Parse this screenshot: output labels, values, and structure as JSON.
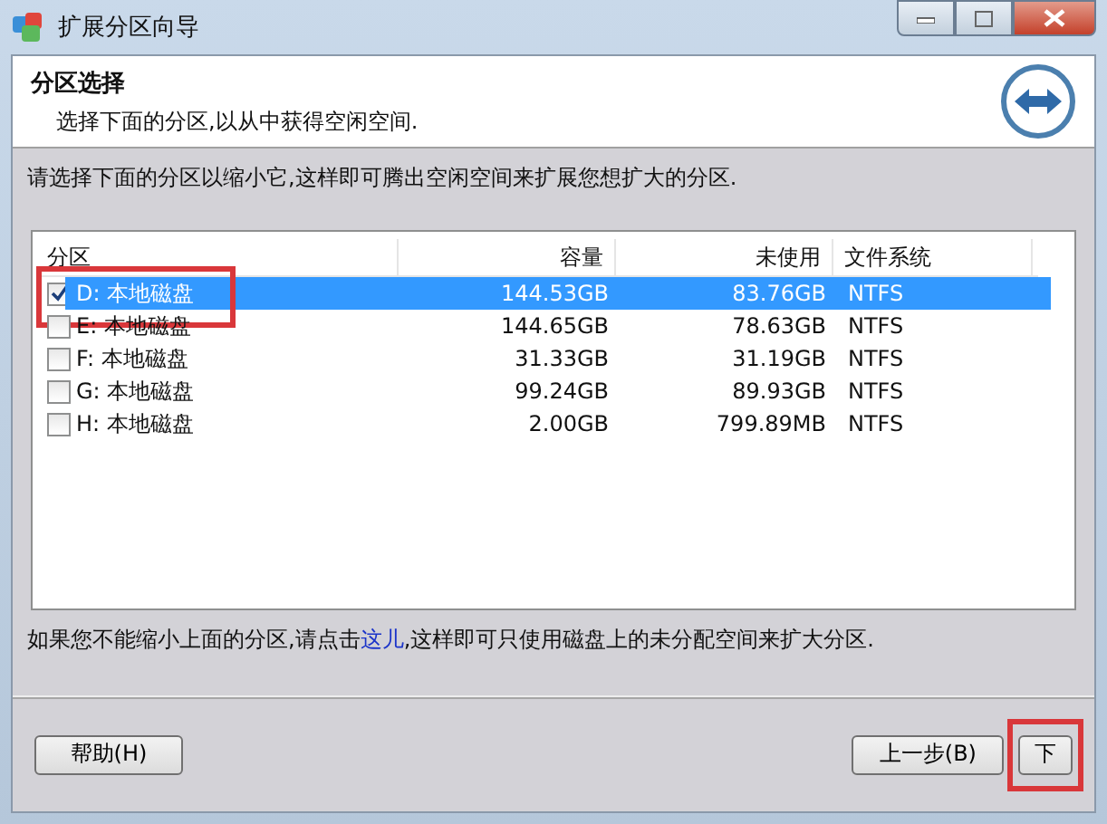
{
  "window": {
    "title": "扩展分区向导"
  },
  "header": {
    "title": "分区选择",
    "subtitle": "选择下面的分区,以从中获得空闲空间."
  },
  "instruction": "请选择下面的分区以缩小它,这样即可腾出空闲空间来扩展您想扩大的分区.",
  "table": {
    "columns": [
      "分区",
      "容量",
      "未使用",
      "文件系统"
    ],
    "rows": [
      {
        "name": "D: 本地磁盘",
        "capacity": "144.53GB",
        "unused": "83.76GB",
        "fs": "NTFS",
        "checked": true,
        "selected": true,
        "highlighted": true
      },
      {
        "name": "E: 本地磁盘",
        "capacity": "144.65GB",
        "unused": "78.63GB",
        "fs": "NTFS",
        "checked": false,
        "selected": false,
        "highlighted": false
      },
      {
        "name": "F: 本地磁盘",
        "capacity": "31.33GB",
        "unused": "31.19GB",
        "fs": "NTFS",
        "checked": false,
        "selected": false,
        "highlighted": false
      },
      {
        "name": "G: 本地磁盘",
        "capacity": "99.24GB",
        "unused": "89.93GB",
        "fs": "NTFS",
        "checked": false,
        "selected": false,
        "highlighted": false
      },
      {
        "name": "H: 本地磁盘",
        "capacity": "2.00GB",
        "unused": "799.89MB",
        "fs": "NTFS",
        "checked": false,
        "selected": false,
        "highlighted": false
      }
    ]
  },
  "note": {
    "before": "如果您不能缩小上面的分区,请点击",
    "link": "这儿",
    "after": ",这样即可只使用磁盘上的未分配空间来扩大分区."
  },
  "buttons": [
    {
      "label": "帮助(H)",
      "kind": "help",
      "highlighted": false
    },
    {
      "label": "上一步(B)",
      "kind": "back",
      "highlighted": false
    },
    {
      "label": "下",
      "kind": "next",
      "highlighted": true
    }
  ]
}
